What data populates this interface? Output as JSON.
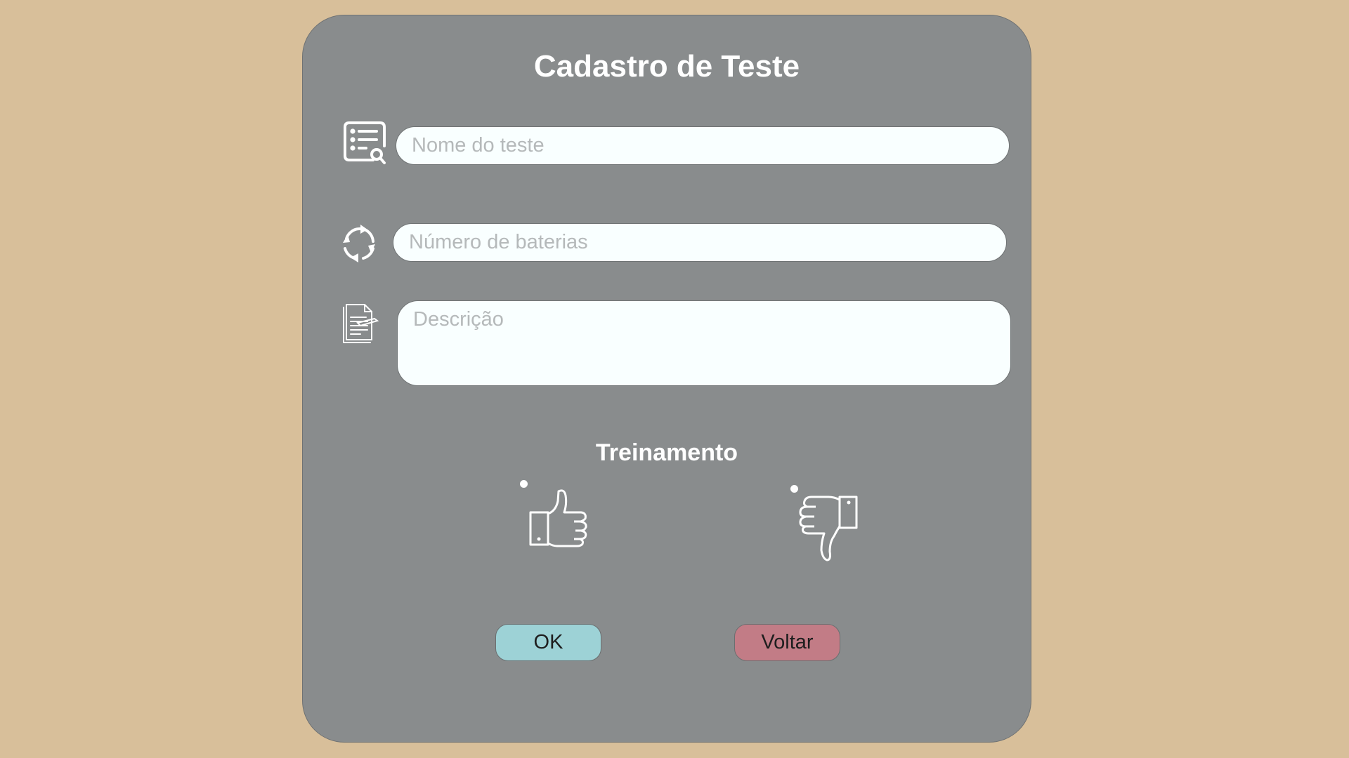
{
  "form": {
    "title": "Cadastro de Teste",
    "fields": {
      "name": {
        "placeholder": "Nome do teste",
        "value": ""
      },
      "batteries": {
        "placeholder": "Número de baterias",
        "value": ""
      },
      "description": {
        "placeholder": "Descrição",
        "value": ""
      }
    },
    "training": {
      "label": "Treinamento",
      "options": [
        {
          "icon": "thumbs-up-icon"
        },
        {
          "icon": "thumbs-down-icon"
        }
      ]
    },
    "buttons": {
      "ok_label": "OK",
      "back_label": "Voltar"
    }
  },
  "colors": {
    "background": "#d8bf9a",
    "panel": "#898c8d",
    "field": "#f9ffff",
    "ok_button": "#9dd2d6",
    "back_button": "#c27c86"
  },
  "icons": {
    "name": "list-search-icon",
    "batteries": "cycle-arrows-icon",
    "description": "document-pen-icon"
  }
}
